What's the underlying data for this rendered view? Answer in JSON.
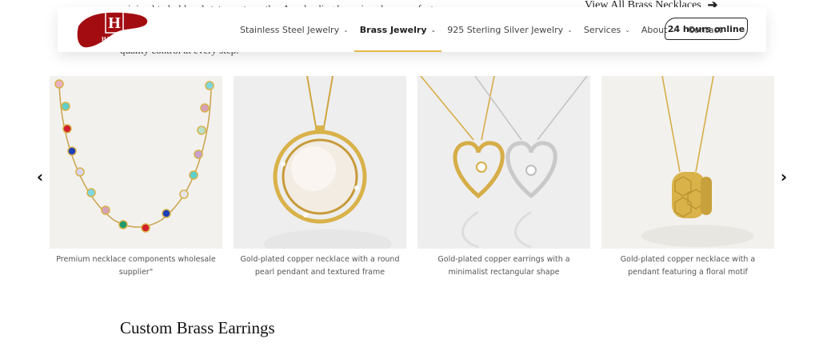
{
  "background_text": {
    "line1": "minimal to bold and statement worthy. As a leading brass jewelry manufacturer, we",
    "line2": "quality control at every step."
  },
  "view_all": {
    "label": "View All Brass Necklaces",
    "icon": "arrow-right-icon"
  },
  "header": {
    "logo_text": "HONGO",
    "nav": [
      {
        "label": "Stainless Steel Jewelry",
        "dropdown": true,
        "active": false
      },
      {
        "label": "Brass Jewelry",
        "dropdown": true,
        "active": true
      },
      {
        "label": "925 Sterling Silver Jewelry",
        "dropdown": true,
        "active": false
      },
      {
        "label": "Services",
        "dropdown": true,
        "active": false
      },
      {
        "label": "About",
        "dropdown": true,
        "active": false
      },
      {
        "label": "Contact",
        "dropdown": false,
        "active": false
      }
    ],
    "cta_label": "24 hours online",
    "active_color": "#e3b94a"
  },
  "carousel": {
    "prev_icon": "chevron-left-icon",
    "next_icon": "chevron-right-icon",
    "items": [
      {
        "caption": "Premium necklace components wholesale supplier\"",
        "image": "multicolor heart crystal necklace"
      },
      {
        "caption": "Gold-plated copper necklace with a round pearl pendant and textured frame",
        "image": "round pearl pendant necklace"
      },
      {
        "caption": "Gold-plated copper earrings with a minimalist rectangular shape",
        "image": "gold and silver heart pendants"
      },
      {
        "caption": "Gold-plated copper necklace with a pendant featuring a floral motif",
        "image": "gold cylinder pendant necklace"
      }
    ]
  },
  "section": {
    "title": "Custom Brass Earrings"
  },
  "colors": {
    "logo_red": "#a30d12",
    "gold": "#d8b24a",
    "silver": "#c9c9c9"
  }
}
